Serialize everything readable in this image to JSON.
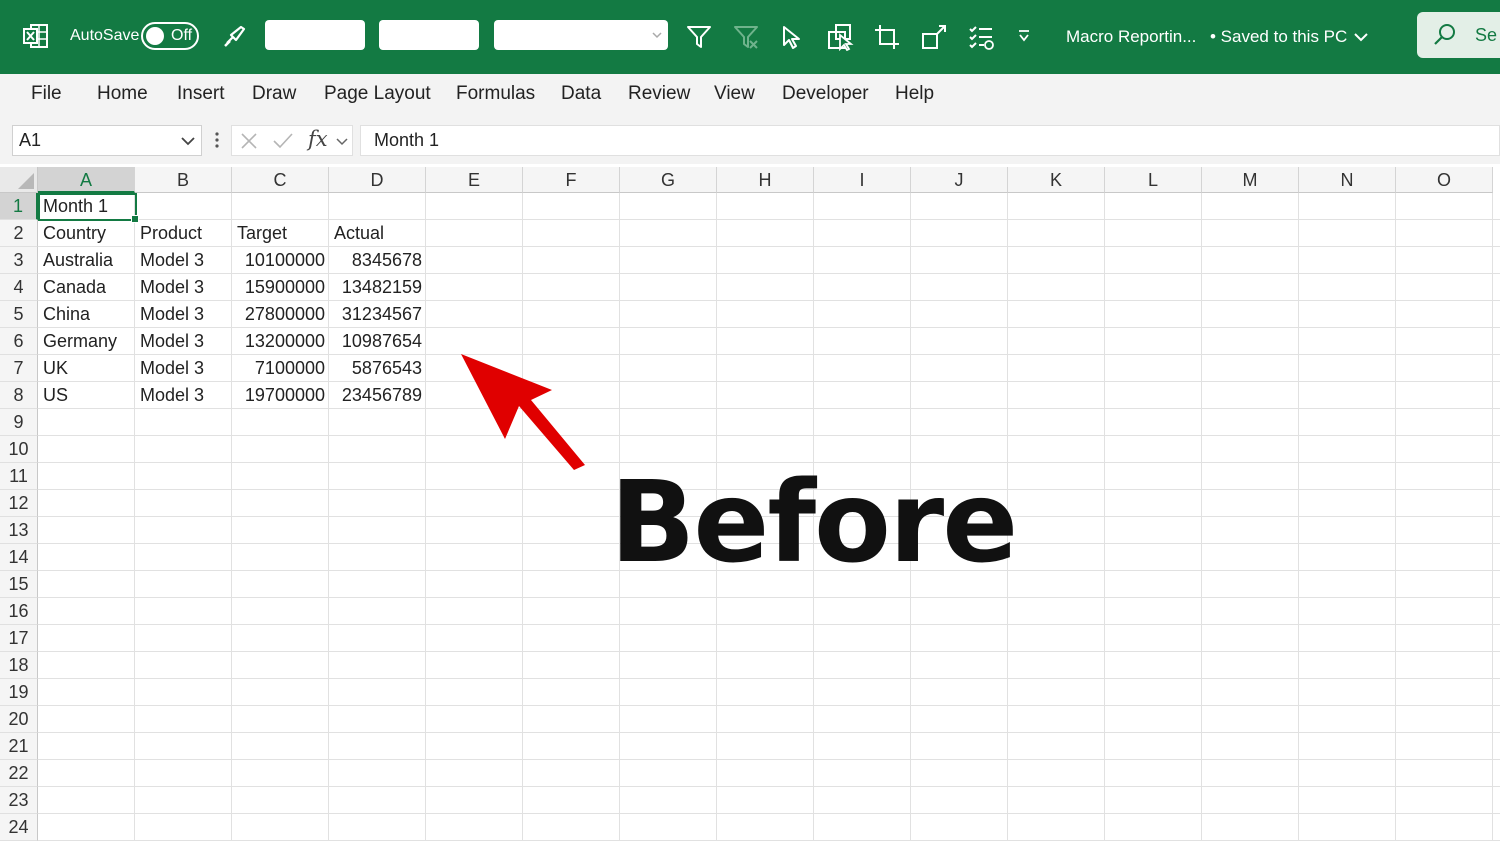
{
  "titlebar": {
    "autosave_label": "AutoSave",
    "autosave_state": "Off",
    "doc_title": "Macro Reportin...",
    "save_status": "• Saved to this PC",
    "search_label": "Se",
    "accent": "#137a43"
  },
  "menu": [
    "File",
    "Home",
    "Insert",
    "Draw",
    "Page Layout",
    "Formulas",
    "Data",
    "Review",
    "View",
    "Developer",
    "Help"
  ],
  "formula_bar": {
    "name_box": "A1",
    "fx_symbol": "fx",
    "formula": "Month 1"
  },
  "sheet": {
    "columns": [
      "A",
      "B",
      "C",
      "D",
      "E",
      "F",
      "G",
      "H",
      "I",
      "J",
      "K",
      "L",
      "M",
      "N",
      "O"
    ],
    "rows": [
      "1",
      "2",
      "3",
      "4",
      "5",
      "6",
      "7",
      "8",
      "9",
      "10",
      "11",
      "12",
      "13",
      "14",
      "15",
      "16",
      "17",
      "18",
      "19",
      "20",
      "21",
      "22",
      "23",
      "24"
    ],
    "active_cell": "A1",
    "cells": {
      "a1": "Month 1",
      "header": [
        "Country",
        "Product",
        "Target",
        "Actual"
      ],
      "data": [
        [
          "Australia",
          "Model 3",
          "10100000",
          "8345678"
        ],
        [
          "Canada",
          "Model 3",
          "15900000",
          "13482159"
        ],
        [
          "China",
          "Model 3",
          "27800000",
          "31234567"
        ],
        [
          "Germany",
          "Model 3",
          "13200000",
          "10987654"
        ],
        [
          "UK",
          "Model 3",
          "7100000",
          "5876543"
        ],
        [
          "US",
          "Model 3",
          "19700000",
          "23456789"
        ]
      ]
    }
  },
  "annotation": {
    "text": "Before",
    "arrow_color": "#e00000"
  }
}
